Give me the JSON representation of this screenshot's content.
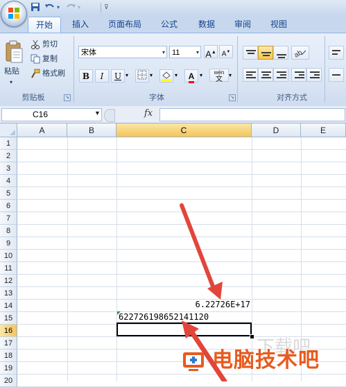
{
  "quick_access": {
    "undo_icon": "undo-icon",
    "redo_icon": "redo-icon",
    "save_icon": "save-icon"
  },
  "tabs": [
    "开始",
    "插入",
    "页面布局",
    "公式",
    "数据",
    "审阅",
    "视图"
  ],
  "ribbon": {
    "clipboard": {
      "paste": "粘贴",
      "cut": "剪切",
      "copy": "复制",
      "format_painter": "格式刷",
      "group_label": "剪贴板"
    },
    "font": {
      "font_name": "宋体",
      "font_size": "11",
      "bold": "B",
      "italic": "I",
      "underline": "U",
      "font_color_letter": "A",
      "grow_font": "A",
      "shrink_font": "A",
      "phonetic": "wén",
      "group_label": "字体"
    },
    "alignment": {
      "group_label": "对齐方式"
    }
  },
  "formula_bar": {
    "name_box": "C16",
    "fx": "fx",
    "formula": ""
  },
  "columns": [
    "A",
    "B",
    "C",
    "D",
    "E"
  ],
  "rows": [
    "1",
    "2",
    "3",
    "4",
    "5",
    "6",
    "7",
    "8",
    "9",
    "10",
    "11",
    "12",
    "13",
    "14",
    "15",
    "16",
    "17",
    "18",
    "19",
    "20"
  ],
  "active_cell": {
    "column": "C",
    "row": "16"
  },
  "cells": {
    "C14": "6.22726E+17",
    "C15": "622726198652141120"
  },
  "watermark": {
    "text": "电脑技术吧"
  },
  "colors": {
    "accent": "#15428b",
    "arrow": "#e2463a",
    "watermark": "#e85a1d",
    "selection_header": "#f4c55b"
  }
}
